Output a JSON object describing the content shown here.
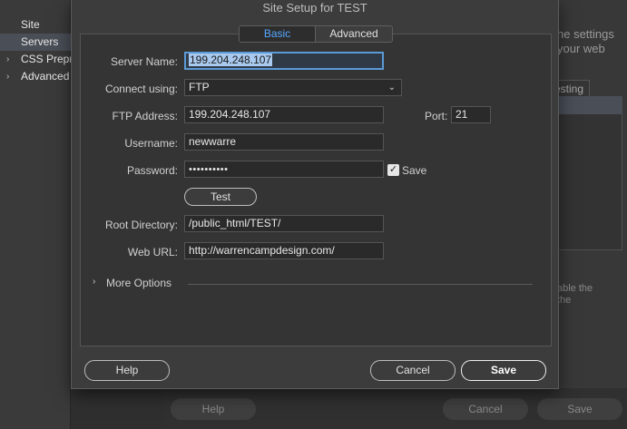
{
  "background": {
    "sidebar": [
      {
        "label": "Site",
        "chevron": ""
      },
      {
        "label": "Servers",
        "chevron": ""
      },
      {
        "label": "CSS Prepro",
        "chevron": "›"
      },
      {
        "label": "Advanced",
        "chevron": "›"
      }
    ],
    "right_text_1": "he settings",
    "right_text_2": "your web",
    "right_tab": "esting",
    "right_small_1": "able the",
    "right_small_2": "the",
    "help_label": "Help",
    "cancel_label": "Cancel",
    "save_label": "Save"
  },
  "dialog": {
    "title": "Site Setup for TEST",
    "tabs": [
      "Basic",
      "Advanced"
    ],
    "server_name": {
      "label": "Server Name:",
      "value": "199.204.248.107"
    },
    "connect_using": {
      "label": "Connect using:",
      "value": "FTP"
    },
    "ftp_address": {
      "label": "FTP Address:",
      "value": "199.204.248.107"
    },
    "port": {
      "label": "Port:",
      "value": "21"
    },
    "username": {
      "label": "Username:",
      "value": "newwarre"
    },
    "password": {
      "label": "Password:",
      "value": "••••••••••"
    },
    "save_checkbox": {
      "label": "Save",
      "checked": true
    },
    "test_button": "Test",
    "root_directory": {
      "label": "Root Directory:",
      "value": "/public_html/TEST/"
    },
    "web_url": {
      "label": "Web URL:",
      "value": "http://warrencampdesign.com/"
    },
    "more_options": "More Options",
    "buttons": {
      "help": "Help",
      "cancel": "Cancel",
      "save": "Save"
    }
  }
}
